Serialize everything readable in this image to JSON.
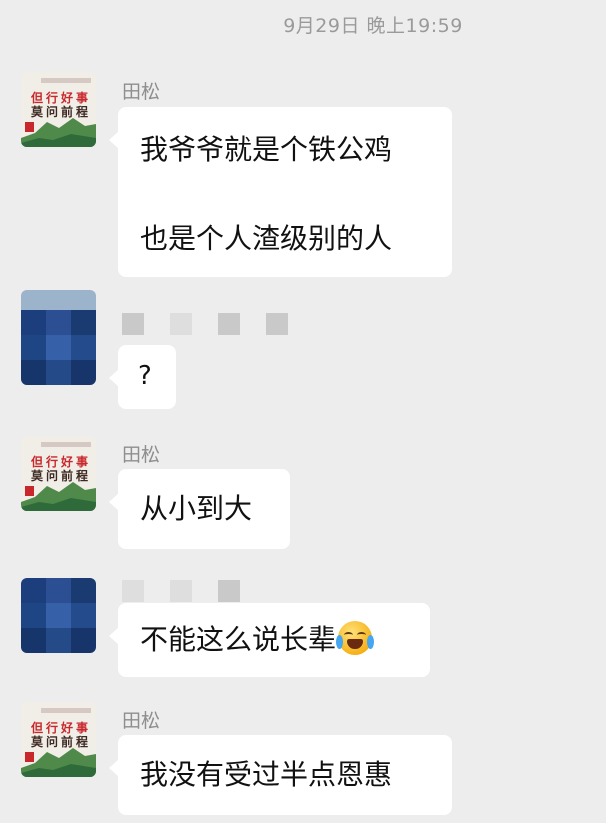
{
  "timestamp": "9月29日 晚上19:59",
  "messages": [
    {
      "sender": "田松",
      "lines": [
        "我爷爷就是个铁公鸡",
        "也是个人渣级别的人"
      ]
    },
    {
      "sender": "",
      "lines": [
        "?"
      ]
    },
    {
      "sender": "田松",
      "lines": [
        "从小到大"
      ]
    },
    {
      "sender": "",
      "lines": [
        "不能这么说长辈"
      ],
      "emoji": "loudly-crying-face"
    },
    {
      "sender": "田松",
      "lines": [
        "我没有受过半点恩惠"
      ]
    }
  ],
  "avatar_poster": {
    "line1": "但行好事",
    "line2": "莫问前程"
  },
  "avatar_pixel_colors": [
    "#1d3e7c",
    "#2c4f93",
    "#1a3a72",
    "#1f4684",
    "#3660a8",
    "#244b8c",
    "#16356a",
    "#244a87",
    "#17356a"
  ],
  "avatar_pixel_top_color": "#9bb3cb"
}
